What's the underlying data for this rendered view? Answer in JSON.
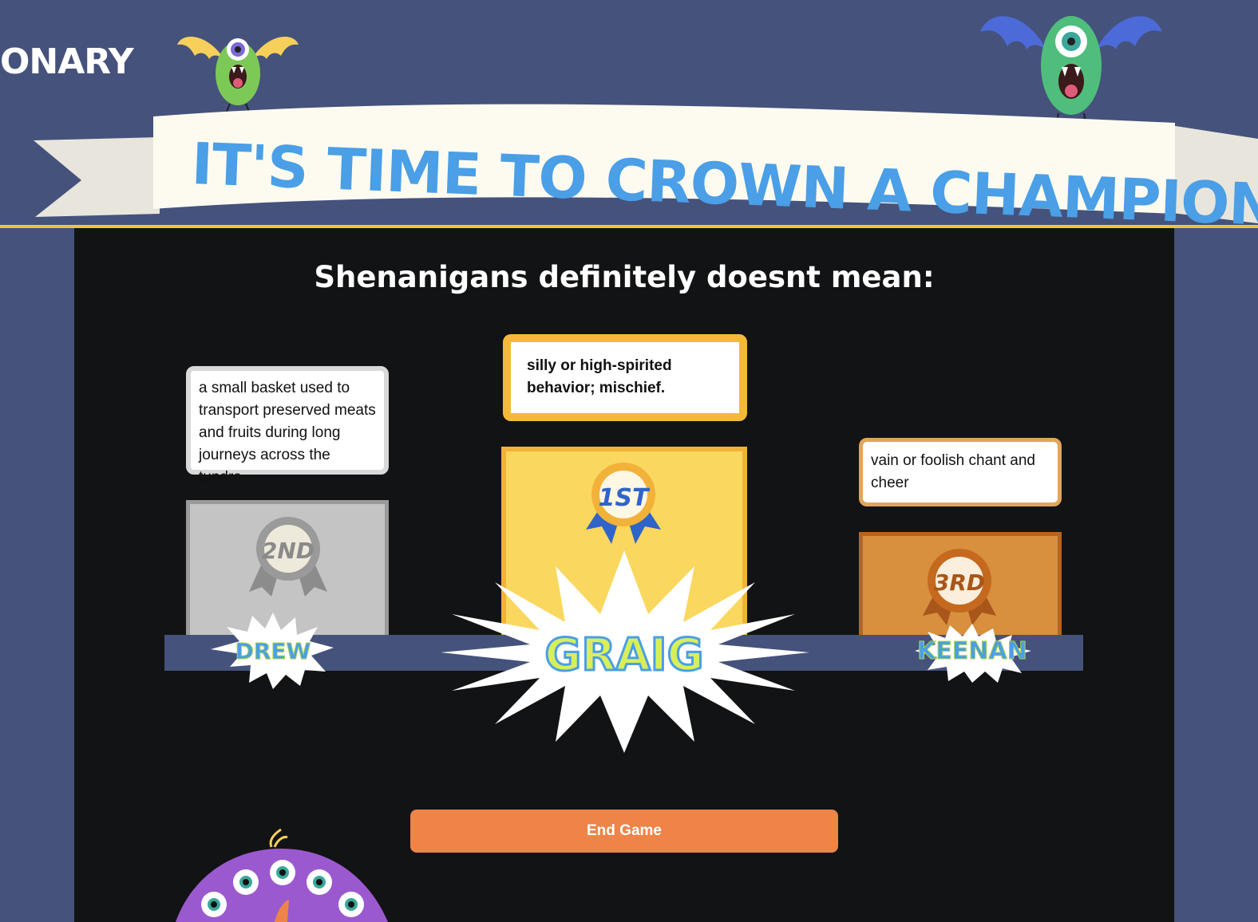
{
  "header": {
    "logo_partial": "ONARY",
    "banner_title": "IT'S TIME TO CROWN A CHAMPION!"
  },
  "question": {
    "prompt": "Shenanigans definitely doesnt mean:"
  },
  "podium": {
    "first": {
      "rank_label": "1ST",
      "player": "GRAIG",
      "answer": "silly or high-spirited behavior; mischief.",
      "color": "#fad75e"
    },
    "second": {
      "rank_label": "2ND",
      "player": "DREW",
      "answer": "a small basket used to transport preserved meats and fruits during long journeys across the tundra",
      "color": "#c4c4c4"
    },
    "third": {
      "rank_label": "3RD",
      "player": "KEENAN",
      "answer": "vain or foolish chant and cheer",
      "color": "#d88f3e"
    }
  },
  "actions": {
    "end_game_label": "End Game"
  },
  "colors": {
    "background": "#45527c",
    "stage": "#121314",
    "banner_text": "#4a9fe6",
    "accent_gold": "#f2c23a",
    "button": "#ee8447"
  }
}
